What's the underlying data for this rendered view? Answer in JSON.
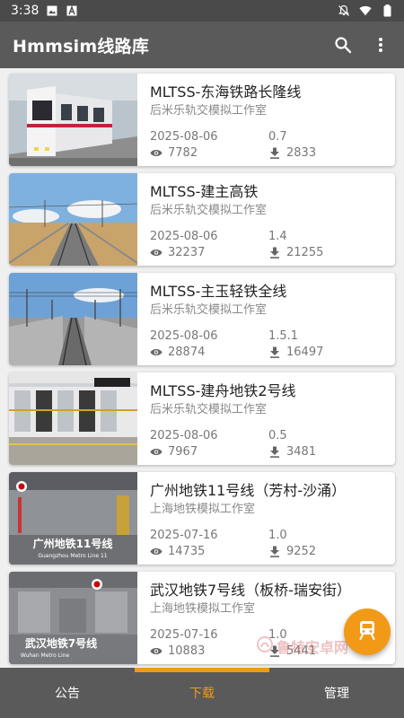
{
  "status_bar": {
    "time": "3:38",
    "icons_left": [
      "image-icon",
      "font-icon"
    ],
    "icons_right": [
      "notifications-off-icon",
      "wifi-icon",
      "battery-icon"
    ]
  },
  "app_bar": {
    "title": "Hmmsim线路库",
    "actions": [
      "search-icon",
      "more-vert-icon"
    ]
  },
  "colors": {
    "accent": "#f29a17",
    "bar": "#5a5a5a",
    "status_bar": "#4a4a4a"
  },
  "routes": [
    {
      "title": "MLTSS-东海铁路长隆线",
      "author": "后米乐轨交模拟工作室",
      "date": "2025-08-06",
      "version": "0.7",
      "views": "7782",
      "downloads": "2833"
    },
    {
      "title": "MLTSS-建主高铁",
      "author": "后米乐轨交模拟工作室",
      "date": "2025-08-06",
      "version": "1.4",
      "views": "32237",
      "downloads": "21255"
    },
    {
      "title": "MLTSS-主玉轻铁全线",
      "author": "后米乐轨交模拟工作室",
      "date": "2025-08-06",
      "version": "1.5.1",
      "views": "28874",
      "downloads": "16497"
    },
    {
      "title": "MLTSS-建舟地铁2号线",
      "author": "后米乐轨交模拟工作室",
      "date": "2025-08-06",
      "version": "0.5",
      "views": "7967",
      "downloads": "3481"
    },
    {
      "title": "广州地铁11号线（芳村-沙涌）",
      "author": "上海地铁模拟工作室",
      "date": "2025-07-16",
      "version": "1.0",
      "views": "14735",
      "downloads": "9252",
      "thumb_caption": "广州地铁11号线",
      "thumb_caption_en": "Guangzhou Metro Line 11"
    },
    {
      "title": "武汉地铁7号线（板桥-瑞安街）",
      "author": "上海地铁模拟工作室",
      "date": "2025-07-16",
      "version": "1.0",
      "views": "10883",
      "downloads": "5441",
      "thumb_caption": "武汉地铁7号线",
      "thumb_caption_en": "Wuhan Metro Line"
    }
  ],
  "fab": {
    "icon": "train-icon"
  },
  "watermark": "鲁特安卓网",
  "bottom_nav": [
    {
      "label": "公告",
      "active": false
    },
    {
      "label": "下载",
      "active": true
    },
    {
      "label": "管理",
      "active": false
    }
  ]
}
